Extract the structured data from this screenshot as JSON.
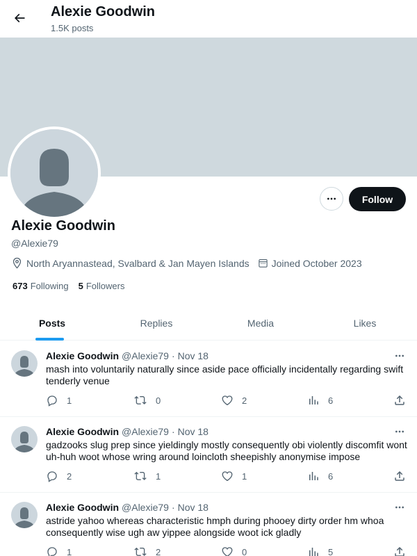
{
  "header": {
    "title": "Alexie Goodwin",
    "subtitle": "1.5K posts"
  },
  "profile": {
    "name": "Alexie Goodwin",
    "handle": "@Alexie79",
    "location": "North Aryannastead, Svalbard & Jan Mayen Islands",
    "joined": "Joined October 2023",
    "following_count": "673",
    "following_label": "Following",
    "followers_count": "5",
    "followers_label": "Followers",
    "follow_label": "Follow"
  },
  "tabs": [
    {
      "label": "Posts",
      "active": true
    },
    {
      "label": "Replies",
      "active": false
    },
    {
      "label": "Media",
      "active": false
    },
    {
      "label": "Likes",
      "active": false
    }
  ],
  "posts": [
    {
      "name": "Alexie Goodwin",
      "handle": "@Alexie79",
      "dot": "·",
      "date": "Nov 18",
      "text": "mash into voluntarily naturally since aside pace officially incidentally regarding swift tenderly venue",
      "replies": "1",
      "reposts": "0",
      "likes": "2",
      "views": "6"
    },
    {
      "name": "Alexie Goodwin",
      "handle": "@Alexie79",
      "dot": "·",
      "date": "Nov 18",
      "text": "gadzooks slug prep since yieldingly mostly consequently obi violently discomfit wont uh-huh woot whose wring around loincloth sheepishly anonymise impose",
      "replies": "2",
      "reposts": "1",
      "likes": "1",
      "views": "6"
    },
    {
      "name": "Alexie Goodwin",
      "handle": "@Alexie79",
      "dot": "·",
      "date": "Nov 18",
      "text": "astride yahoo whereas characteristic hmph during phooey dirty order hm whoa consequently wise ugh aw yippee alongside woot ick gladly",
      "replies": "1",
      "reposts": "2",
      "likes": "0",
      "views": "5"
    }
  ],
  "icons": {
    "back": "arrow-left-icon",
    "more": "more-horizontal-icon",
    "location": "location-pin-icon",
    "calendar": "calendar-icon",
    "reply": "reply-icon",
    "repost": "repost-icon",
    "like": "heart-icon",
    "views": "views-icon",
    "share": "share-icon"
  },
  "colors": {
    "accent": "#1d9bf0",
    "banner": "#cfd9de",
    "follow_button": "#0f1419",
    "secondary_text": "#536471"
  }
}
